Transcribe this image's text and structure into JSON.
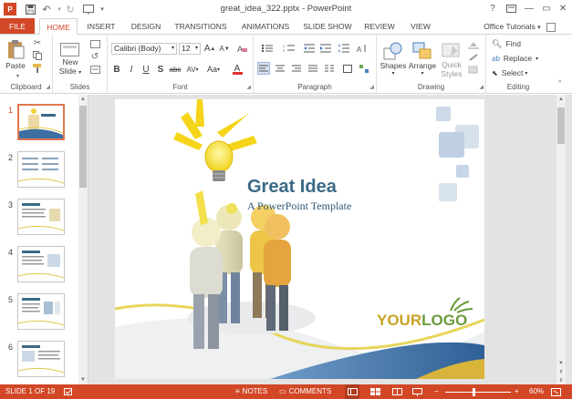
{
  "window": {
    "title": "great_idea_322.pptx - PowerPoint",
    "help": "?",
    "minimize": "—",
    "restore": "▭",
    "close": "✕"
  },
  "account": "Office Tutorials",
  "tabs": [
    "FILE",
    "HOME",
    "INSERT",
    "DESIGN",
    "TRANSITIONS",
    "ANIMATIONS",
    "SLIDE SHOW",
    "REVIEW",
    "VIEW"
  ],
  "ribbon": {
    "clipboard": {
      "label": "Clipboard",
      "paste": "Paste"
    },
    "slides": {
      "label": "Slides",
      "new_slide": "New",
      "new_slide2": "Slide"
    },
    "font": {
      "label": "Font",
      "family": "Calibri (Body)",
      "size": "12",
      "bold": "B",
      "italic": "I",
      "underline": "U",
      "strike": "S",
      "shadow": "abc",
      "spacing": "AV",
      "case": "Aa",
      "color": "A",
      "grow": "A",
      "shrink": "A"
    },
    "paragraph": {
      "label": "Paragraph"
    },
    "drawing": {
      "label": "Drawing",
      "shapes": "Shapes",
      "arrange": "Arrange",
      "quick": "Quick",
      "styles": "Styles"
    },
    "editing": {
      "label": "Editing",
      "find": "Find",
      "replace": "Replace",
      "select": "Select"
    }
  },
  "thumbnails": [
    "1",
    "2",
    "3",
    "4",
    "5",
    "6"
  ],
  "slide": {
    "title": "Great Idea",
    "subtitle": "A PowerPoint Template",
    "logo_your": "YOUR",
    "logo_logo": "LOGO"
  },
  "status": {
    "slide": "SLIDE 1 OF 19",
    "notes": "NOTES",
    "comments": "COMMENTS",
    "zoom": "60%",
    "minus": "−",
    "plus": "+"
  },
  "colors": {
    "accent": "#d24726",
    "title": "#3b6a86",
    "logo_gold": "#c9a227",
    "logo_green": "#6b9a3a"
  }
}
